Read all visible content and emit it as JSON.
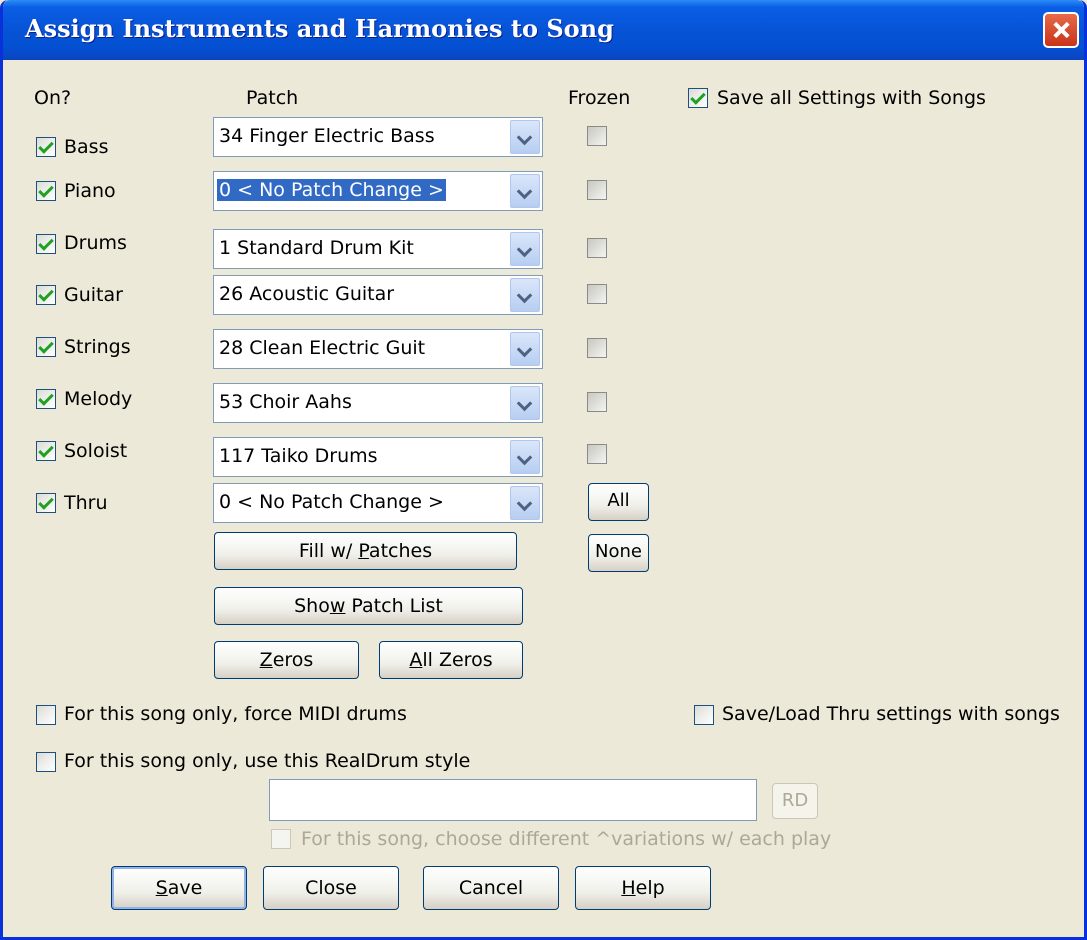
{
  "window": {
    "title": "Assign Instruments and Harmonies to Song"
  },
  "headers": {
    "on": "On?",
    "patch": "Patch",
    "frozen": "Frozen"
  },
  "save_all": {
    "label": "Save all Settings with Songs",
    "checked": true
  },
  "rows": [
    {
      "label": "Bass",
      "patch": "34 Finger Electric Bass"
    },
    {
      "label": "Piano",
      "patch": "0 < No Patch Change >"
    },
    {
      "label": "Drums",
      "patch": "1 Standard Drum Kit"
    },
    {
      "label": "Guitar",
      "patch": "26 Acoustic Guitar"
    },
    {
      "label": "Strings",
      "patch": "28 Clean Electric Guit"
    },
    {
      "label": "Melody",
      "patch": "53 Choir Aahs"
    },
    {
      "label": "Soloist",
      "patch": "117 Taiko Drums"
    },
    {
      "label": "Thru",
      "patch": "0 < No Patch Change >"
    }
  ],
  "frozen_buttons": {
    "all": "All",
    "none": "None"
  },
  "patch_buttons": {
    "fill": {
      "pre": "Fill w/ ",
      "key": "P",
      "post": "atches"
    },
    "show": {
      "pre": "Sho",
      "key": "w",
      "post": " Patch List"
    },
    "zeros": {
      "pre": "",
      "key": "Z",
      "post": "eros"
    },
    "all_zeros": {
      "pre": "",
      "key": "A",
      "post": "ll Zeros"
    }
  },
  "options": {
    "force_midi": "For this song only, force MIDI drums",
    "save_thru": "Save/Load Thru settings with songs",
    "realdrum": "For this song only, use this RealDrum style",
    "realdrum_value": "",
    "rd_button": "RD",
    "variations": "For this song, choose different ^variations w/ each play"
  },
  "footer": {
    "save": {
      "pre": "",
      "key": "S",
      "post": "ave"
    },
    "close": "Close",
    "cancel": "Cancel",
    "help": {
      "pre": "",
      "key": "H",
      "post": "elp"
    }
  }
}
